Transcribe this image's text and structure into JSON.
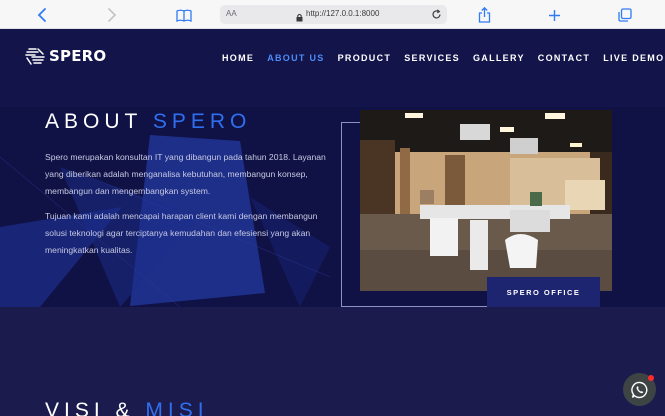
{
  "browser": {
    "text_size_label": "AA",
    "url": "http://127.0.0.1:8000",
    "icons": [
      "back-icon",
      "forward-icon",
      "book-icon",
      "lock-icon",
      "reload-icon",
      "share-icon",
      "new-tab-icon",
      "tabs-icon"
    ]
  },
  "brand": {
    "name": "SPERO"
  },
  "nav": {
    "items": [
      {
        "label": "HOME"
      },
      {
        "label": "ABOUT US",
        "active": true
      },
      {
        "label": "PRODUCT"
      },
      {
        "label": "SERVICES"
      },
      {
        "label": "GALLERY"
      },
      {
        "label": "CONTACT"
      },
      {
        "label": "LIVE DEMO"
      }
    ]
  },
  "about": {
    "title": "ABOUT",
    "title_accent": "SPERO",
    "paragraph1": "Spero merupakan konsultan IT yang dibangun pada tahun 2018. Layanan yang diberikan adalah menganalisa kebutuhan, membangun konsep, membangun dan mengembangkan system.",
    "paragraph2": "Tujuan kami adalah mencapai harapan client kami dengan membangun solusi teknologi agar terciptanya kemudahan dan efesiensi yang akan meningkatkan kualitas.",
    "photo_label": "SPERO OFFICE"
  },
  "visi": {
    "title": "VISI &",
    "title_accent": "MISI"
  },
  "colors": {
    "navbar_bg": "#13144a",
    "section_bg": "#101245",
    "accent": "#2f6fef",
    "active_nav": "#4d8cf7",
    "label_bg": "#1d2470",
    "whatsapp_bubble": "#3e4444",
    "notification_dot": "#ff2b2b"
  },
  "widgets": {
    "chat": "whatsapp-icon"
  }
}
